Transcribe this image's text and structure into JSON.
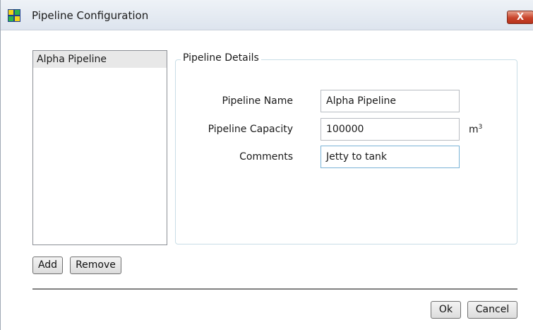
{
  "window": {
    "title": "Pipeline Configuration",
    "close_label": "X"
  },
  "pipeline_list": {
    "items": [
      "Alpha Pipeline"
    ],
    "selected_index": 0
  },
  "details": {
    "group_title": "Pipeline Details",
    "name_label": "Pipeline Name",
    "name_value": "Alpha Pipeline",
    "capacity_label": "Pipeline Capacity",
    "capacity_value": "100000",
    "capacity_unit": "m",
    "capacity_unit_exp": "3",
    "comments_label": "Comments",
    "comments_value": "Jetty to tank"
  },
  "buttons": {
    "add_label": "Add",
    "remove_label": "Remove",
    "ok_label": "Ok",
    "cancel_label": "Cancel"
  },
  "icons": {
    "app": "grid-window-icon",
    "close": "close-icon"
  }
}
